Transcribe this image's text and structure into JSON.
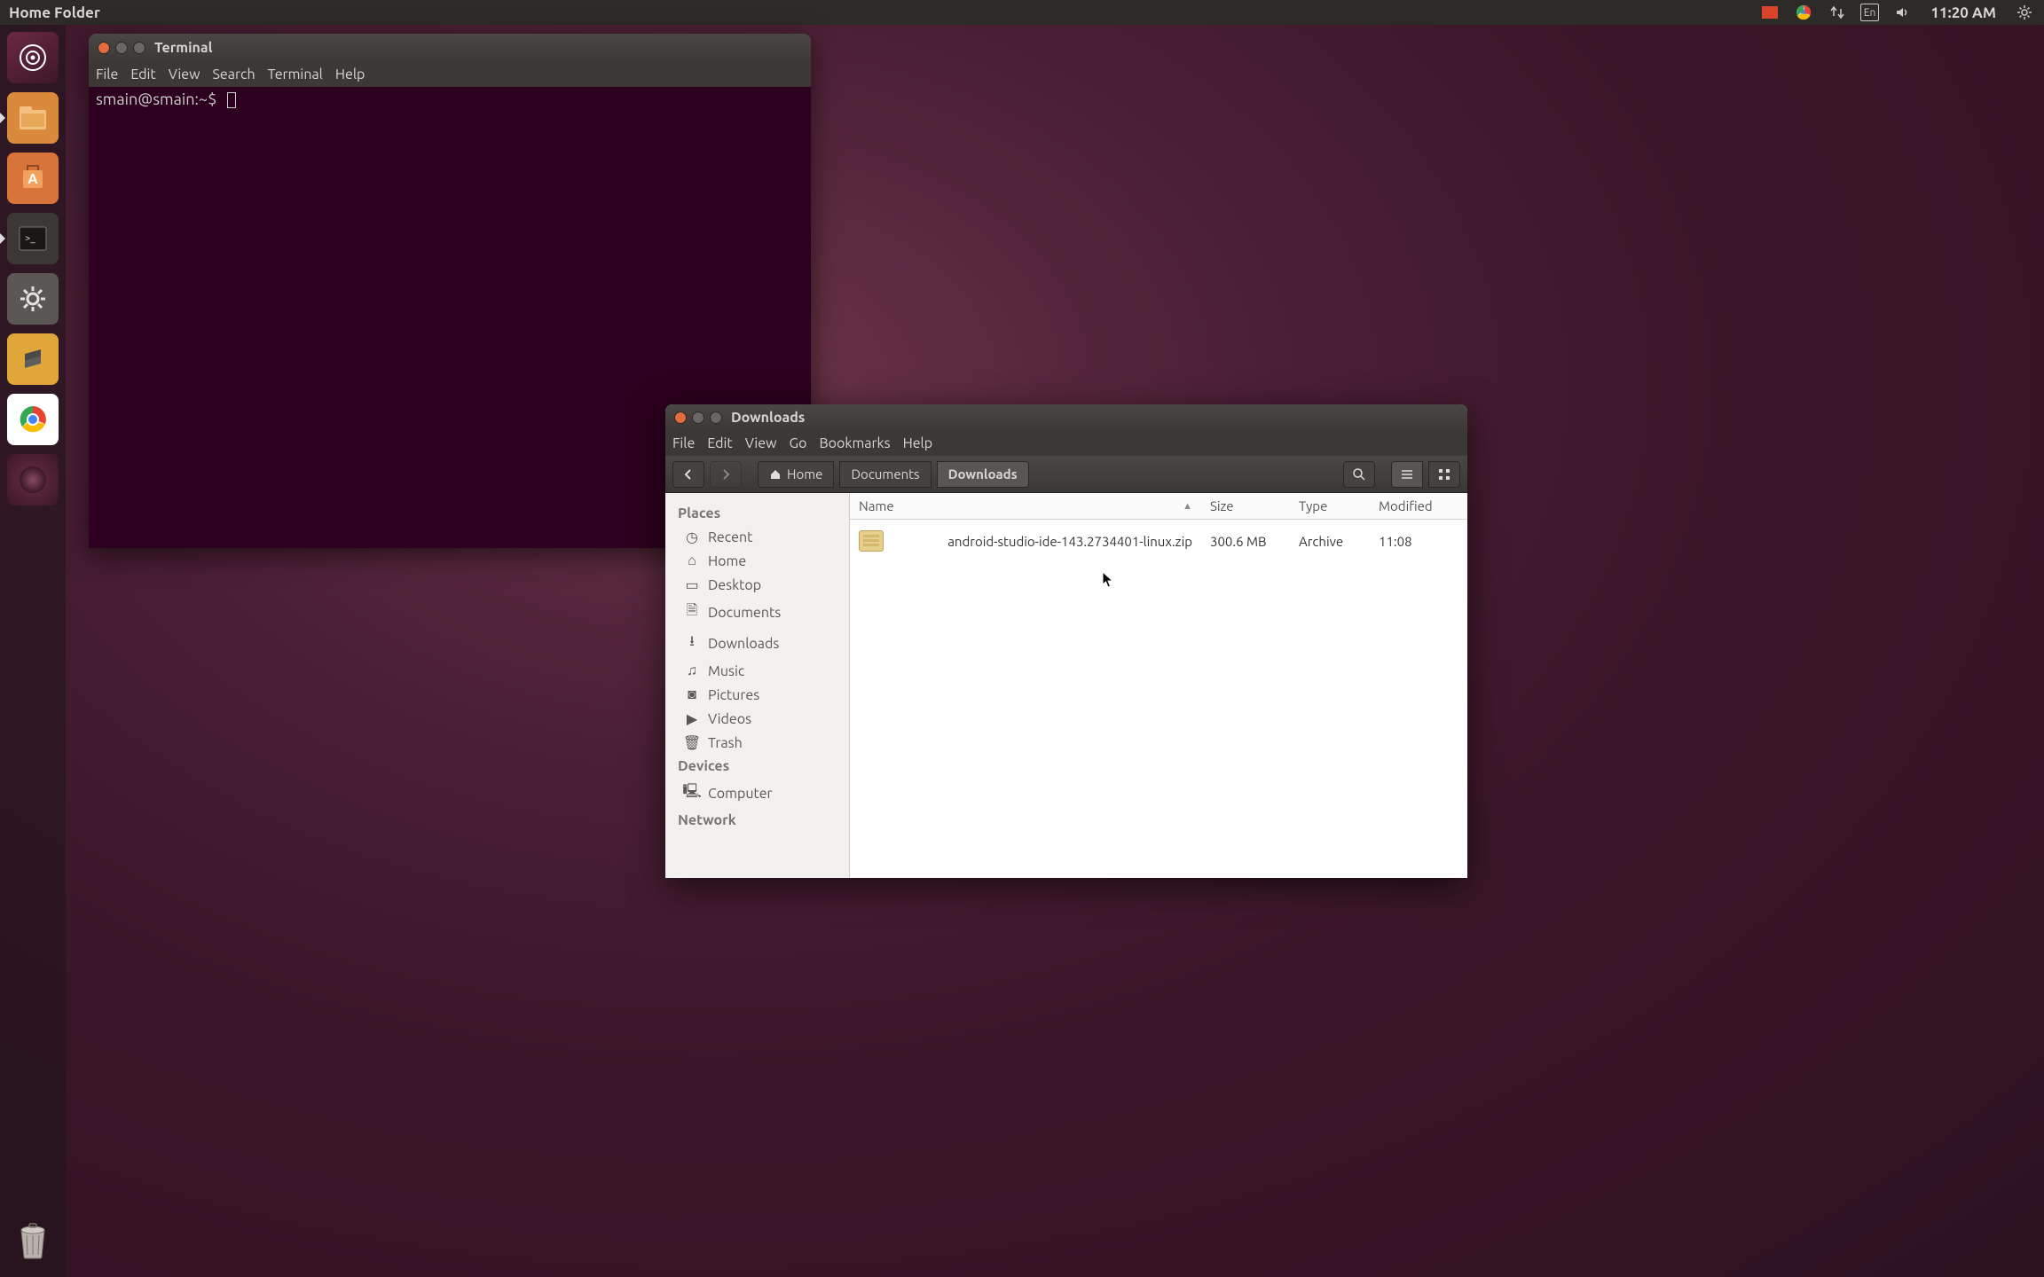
{
  "menubar": {
    "title": "Home Folder",
    "indicators": {
      "keyboard": "En",
      "clock": "11:20 AM"
    }
  },
  "launcher": {
    "items": [
      {
        "name": "dash"
      },
      {
        "name": "files"
      },
      {
        "name": "software-center"
      },
      {
        "name": "terminal"
      },
      {
        "name": "settings"
      },
      {
        "name": "sublime"
      },
      {
        "name": "chrome"
      },
      {
        "name": "workspace"
      }
    ]
  },
  "terminal": {
    "title": "Terminal",
    "menu": [
      "File",
      "Edit",
      "View",
      "Search",
      "Terminal",
      "Help"
    ],
    "prompt": "smain@smain:~$"
  },
  "filemgr": {
    "title": "Downloads",
    "menu": [
      "File",
      "Edit",
      "View",
      "Go",
      "Bookmarks",
      "Help"
    ],
    "breadcrumb": [
      "Home",
      "Documents",
      "Downloads"
    ],
    "columns": {
      "name": "Name",
      "size": "Size",
      "type": "Type",
      "modified": "Modified"
    },
    "sidebar": {
      "places_header": "Places",
      "places": [
        "Recent",
        "Home",
        "Desktop",
        "Documents",
        "Downloads",
        "Music",
        "Pictures",
        "Videos",
        "Trash"
      ],
      "devices_header": "Devices",
      "devices": [
        "Computer"
      ],
      "network_header": "Network"
    },
    "files": [
      {
        "name": "android-studio-ide-143.2734401-linux.zip",
        "size": "300.6 MB",
        "type": "Archive",
        "modified": "11:08"
      }
    ]
  }
}
